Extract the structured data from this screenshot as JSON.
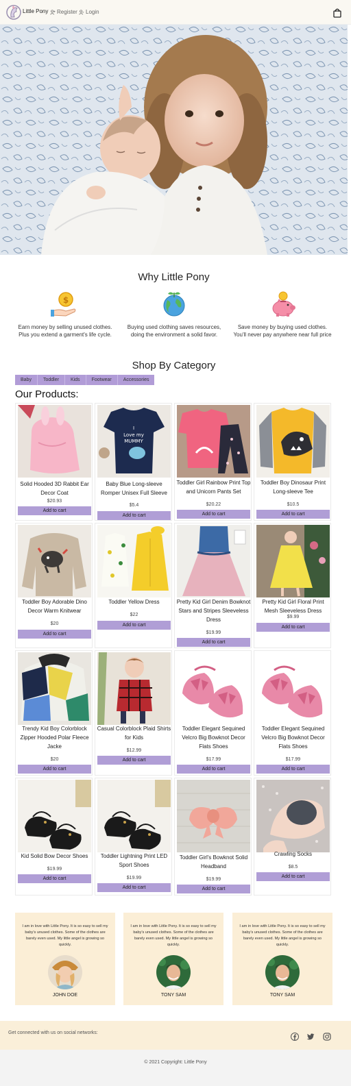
{
  "navbar": {
    "brand": "Little Pony",
    "register": "Register",
    "login": "Login"
  },
  "why": {
    "title": "Why Little Pony",
    "features": [
      {
        "icon": "money-hand-icon",
        "text": "Earn money by selling unused clothes. Plus you extend a garment's life cycle."
      },
      {
        "icon": "earth-plant-icon",
        "text": "Buying used clothing saves resources, doing the environment a solid favor."
      },
      {
        "icon": "piggy-bank-icon",
        "text": "Save money by buying used clothes. You'll never pay anywhere near full price"
      }
    ]
  },
  "shop": {
    "title": "Shop By Category",
    "categories": [
      "Baby",
      "Toddler",
      "Kids",
      "Footwear",
      "Accessories"
    ]
  },
  "products_title": "Our Products:",
  "add_to_cart": "Add to cart",
  "products": [
    {
      "name": "Solid Hooded 3D Rabbit Ear Decor Coat",
      "price": "$20.93"
    },
    {
      "name": "Baby Blue Long-sleeve Romper Unisex Full Sleeve",
      "price": "$5.4"
    },
    {
      "name": "Toddler Girl Rainbow Print Top and Unicorn Pants Set",
      "price": "$20.22"
    },
    {
      "name": "Toddler Boy Dinosaur Print Long-sleeve Tee",
      "price": "$10.5"
    },
    {
      "name": "Toddler Boy Adorable Dino Decor Warm Knitwear",
      "price": "$20"
    },
    {
      "name": "Toddler Yellow Dress",
      "price": "$22"
    },
    {
      "name": "Pretty Kid Girl Denim Bowknot Stars and Stripes Sleeveless Dress",
      "price": "$19.99"
    },
    {
      "name": "Pretty Kid Girl Floral Print Mesh Sleeveless Dress",
      "price": "$9.99"
    },
    {
      "name": "Trendy Kid Boy Colorblock Zipper Hooded Polar Fleece Jacke",
      "price": "$20"
    },
    {
      "name": "Casual Colorblock Plaid Shirts for Kids",
      "price": "$12.99"
    },
    {
      "name": "Toddler Elegant Sequined Velcro Big Bowknot Decor Flats Shoes",
      "price": "$17.99"
    },
    {
      "name": "Toddler Elegant Sequined Velcro Big Bowknot Decor Flats Shoes",
      "price": "$17.99"
    },
    {
      "name": "Kid Solid Bow Decor Shoes",
      "price": "$19.99"
    },
    {
      "name": "Toddler Lightning Print LED Sport Shoes",
      "price": "$19.99"
    },
    {
      "name": "Toddler Girl's Bowknot Solid Headband",
      "price": "$19.99"
    },
    {
      "name": "Crawling Socks",
      "price": "$8.5"
    }
  ],
  "testimonials": [
    {
      "quote": "I am in love with Little Pony. It is so easy to sell my baby's unused clothes. Some of the clothes are barely even used. My little angel is growing so quickly.",
      "name": "JOHN DOE"
    },
    {
      "quote": "I am in love with Little Pony. It is so easy to sell my baby's unused clothes. Some of the clothes are barely even used. My little angel is growing so quickly.",
      "name": "TONY SAM"
    },
    {
      "quote": "I am in love with Little Pony. It is so easy to sell my baby's unused clothes. Some of the clothes are barely even used. My little angel is growing so quickly.",
      "name": "TONY SAM"
    }
  ],
  "footer": {
    "social_text": "Get connected with us on social networks:",
    "social_icons": [
      "facebook-icon",
      "twitter-icon",
      "instagram-icon"
    ],
    "copyright": "© 2021 Copyright: Little Pony"
  },
  "colors": {
    "accent": "#b09ed6",
    "navbar_bg": "#faf8f2",
    "testimonial_bg": "#fbeed6",
    "footer_bg": "#faefd9"
  }
}
